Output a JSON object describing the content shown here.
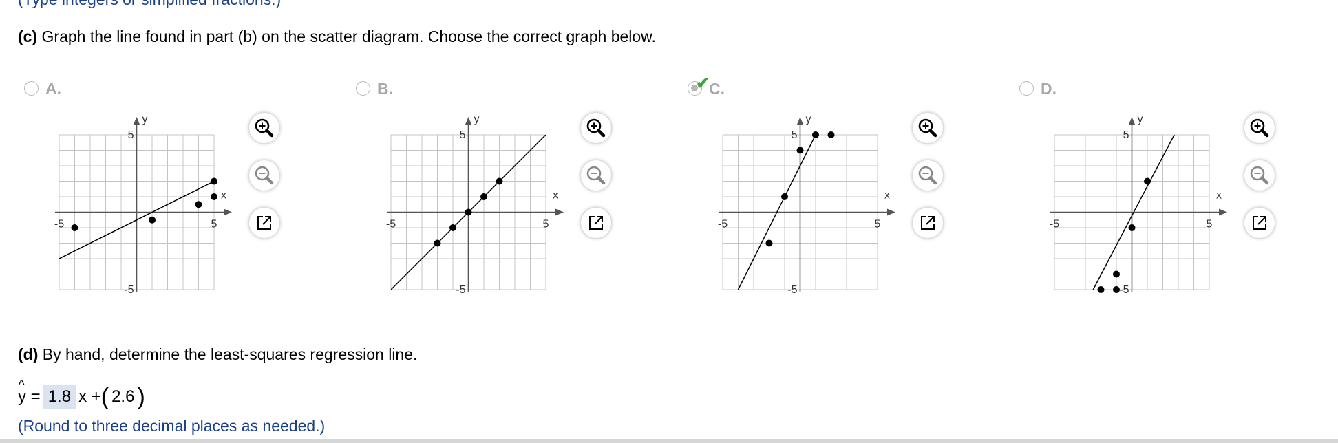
{
  "top_hint": "(Type integers or simplified fractions.)",
  "part_c": {
    "label": "(c)",
    "text": "Graph the line found in part (b) on the scatter diagram. Choose the correct graph below."
  },
  "options": [
    {
      "letter": "A.",
      "selected": false,
      "points": [
        [
          -4,
          -1
        ],
        [
          1,
          -0.5
        ],
        [
          4,
          0.5
        ],
        [
          5,
          2
        ],
        [
          5,
          1
        ]
      ],
      "line": [
        [
          -5,
          -3
        ],
        [
          5,
          2
        ]
      ]
    },
    {
      "letter": "B.",
      "selected": false,
      "points": [
        [
          -2,
          -2
        ],
        [
          -1,
          -1
        ],
        [
          0,
          0
        ],
        [
          1,
          1
        ],
        [
          2,
          2
        ]
      ],
      "line": [
        [
          -5,
          -5
        ],
        [
          5,
          5
        ]
      ]
    },
    {
      "letter": "C.",
      "selected": true,
      "points": [
        [
          -2,
          -2
        ],
        [
          -1,
          1
        ],
        [
          0,
          4
        ],
        [
          1,
          5
        ],
        [
          2,
          5
        ]
      ],
      "line": [
        [
          -4,
          -5
        ],
        [
          1,
          5
        ]
      ]
    },
    {
      "letter": "D.",
      "selected": false,
      "points": [
        [
          -2,
          -5
        ],
        [
          -1,
          -5
        ],
        [
          -1,
          -4
        ],
        [
          0,
          -1
        ],
        [
          1,
          2
        ]
      ],
      "line": [
        [
          -2.5,
          -5
        ],
        [
          3,
          5.5
        ]
      ]
    }
  ],
  "axis": {
    "x_label": "x",
    "y_label": "y",
    "tick_pos": "5",
    "tick_neg": "-5"
  },
  "tools": {
    "zoom_in": "zoom-in-icon",
    "zoom_out": "zoom-out-icon",
    "pop_out": "popout-icon"
  },
  "part_d": {
    "label": "(d)",
    "text": "By hand, determine the least-squares regression line."
  },
  "answer": {
    "lhs": "y =",
    "hat": "^",
    "slope": "1.8",
    "x_plus": "x +",
    "intercept": "2.6"
  },
  "round_note": "(Round to three decimal places as needed.)"
}
